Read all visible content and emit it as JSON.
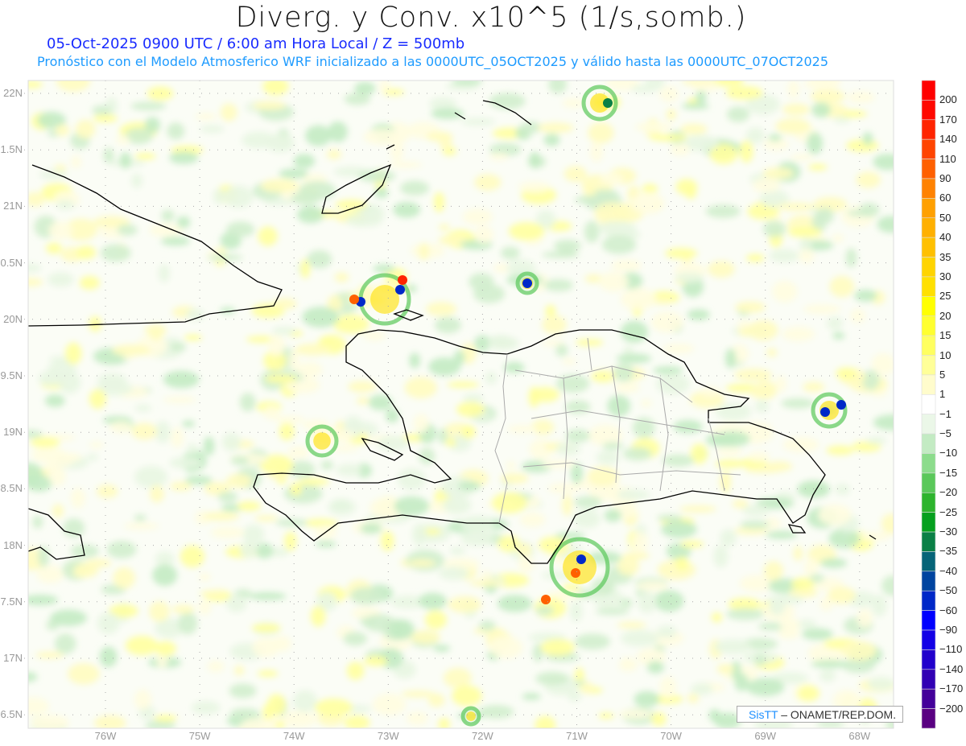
{
  "header": {
    "title": "Diverg. y Conv. x10^5 (1/s,somb.)",
    "subtitle_date": "05-Oct-2025  0900 UTC / 6:00 am Hora Local / Z = 500mb",
    "subtitle_model": "Pronóstico con el Modelo Atmosferico WRF inicializado a las 0000UTC_05OCT2025 y válido hasta las  0000UTC_07OCT2025"
  },
  "axes": {
    "lat_labels": [
      "22N",
      "1.5N",
      "21N",
      "0.5N",
      "20N",
      "9.5N",
      "19N",
      "8.5N",
      "18N",
      "7.5N",
      "17N",
      "6.5N"
    ],
    "lon_labels": [
      "76W",
      "75W",
      "74W",
      "73W",
      "72W",
      "71W",
      "70W",
      "69W",
      "68W"
    ]
  },
  "colorbar": {
    "labels": [
      "200",
      "170",
      "140",
      "110",
      "90",
      "60",
      "50",
      "40",
      "35",
      "30",
      "25",
      "20",
      "15",
      "10",
      "5",
      "1",
      "−1",
      "−5",
      "−10",
      "−15",
      "−20",
      "−25",
      "−30",
      "−35",
      "−40",
      "−50",
      "−60",
      "−90",
      "−110",
      "−140",
      "−170",
      "−200"
    ],
    "colors": [
      "#ff0000",
      "#ff0800",
      "#ff2400",
      "#ff4400",
      "#ff6000",
      "#ff8200",
      "#ffa000",
      "#ffb000",
      "#ffc000",
      "#ffd400",
      "#ffe000",
      "#ffff00",
      "#ffff30",
      "#ffff60",
      "#ffff98",
      "#fffccc",
      "#ffffff",
      "#ebf7e8",
      "#c3ebc3",
      "#8cdc8c",
      "#5ac85a",
      "#2db42d",
      "#05a01e",
      "#0a8046",
      "#066478",
      "#0044a0",
      "#0028c8",
      "#0000ff",
      "#1400e6",
      "#2200cc",
      "#3200b4",
      "#44009a",
      "#5a0082"
    ]
  },
  "credit": {
    "brand": "SisTT",
    "text": "– ONAMET/REP.DOM."
  }
}
